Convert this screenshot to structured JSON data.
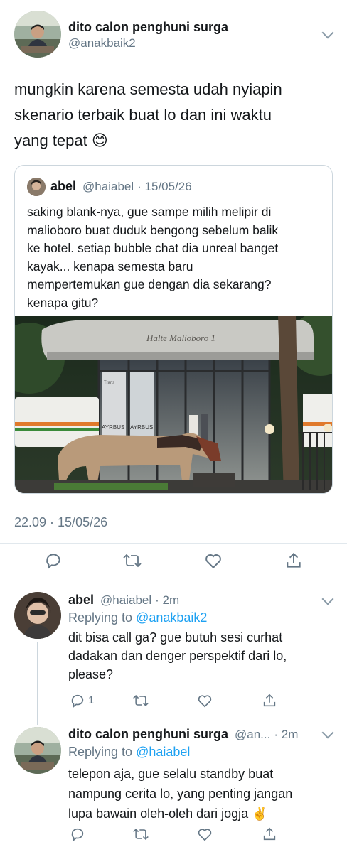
{
  "main_tweet": {
    "name": "dito calon penghuni surga",
    "handle": "@anakbaik2",
    "text_lines": [
      "mungkin karena semesta udah nyiapin",
      "skenario terbaik buat lo dan ini waktu",
      "yang tepat 😊"
    ],
    "timestamp": "22.09 · 15/05/26"
  },
  "quoted_tweet": {
    "name": "abel",
    "handle": "@haiabel",
    "date": "· 15/05/26",
    "text_lines": [
      "saking blank-nya, gue sampe milih melipir di",
      "malioboro buat duduk bengong sebelum balik",
      "ke hotel. setiap bubble chat dia unreal banget",
      "kayak... kenapa semesta baru",
      "mempertemukan gue dengan dia sekarang?",
      "kenapa gitu?"
    ],
    "photo": {
      "sign": "Halte Malioboro 1",
      "poster_left": "AYRBUS",
      "poster_right": "AYRBUS",
      "small_poster": "Trans"
    }
  },
  "replies": [
    {
      "name": "abel",
      "handle": "@haiabel",
      "time": "· 2m",
      "replying_label": "Replying to",
      "replying_to": "@anakbaik2",
      "text_lines": [
        "dit bisa call ga? gue butuh sesi curhat",
        "dadakan dan denger perspektif dari lo,",
        "please?"
      ],
      "reply_count": "1"
    },
    {
      "name": "dito calon penghuni surga",
      "handle": "@an...",
      "time": "· 2m",
      "replying_label": "Replying to",
      "replying_to": "@haiabel",
      "text_lines": [
        "telepon aja, gue selalu standby buat",
        "nampung cerita lo, yang penting jangan",
        "lupa bawain oleh-oleh dari jogja ✌️"
      ]
    }
  ],
  "icons": {
    "reply": "reply-icon",
    "retweet": "retweet-icon",
    "like": "heart-icon",
    "share": "share-icon",
    "more": "chevron-down-icon"
  },
  "colors": {
    "link": "#1da1f2",
    "muted": "#657786",
    "icon": "#657786"
  }
}
